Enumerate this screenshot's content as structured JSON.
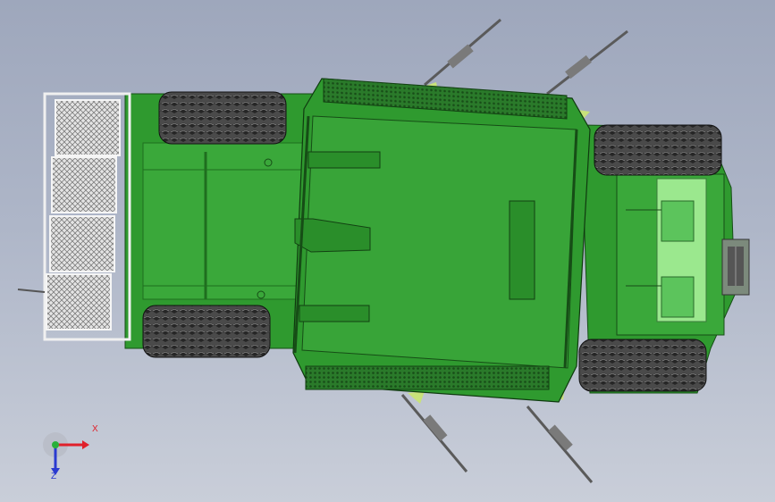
{
  "viewport": {
    "background_top": "#9ea7bc",
    "background_bottom": "#c9ced9"
  },
  "model": {
    "body_color": "#2f9a2f",
    "body_dark": "#1f6e1f",
    "body_light": "#4cb84c",
    "highlight": "#9be88e",
    "tire_color": "#3b3b3b",
    "mesh_color": "#d8d8d8"
  },
  "triad": {
    "x_label": "X",
    "z_label": "Z",
    "x_color": "#e0202a",
    "y_color": "#2ab03a",
    "z_color": "#2a3ad0"
  }
}
